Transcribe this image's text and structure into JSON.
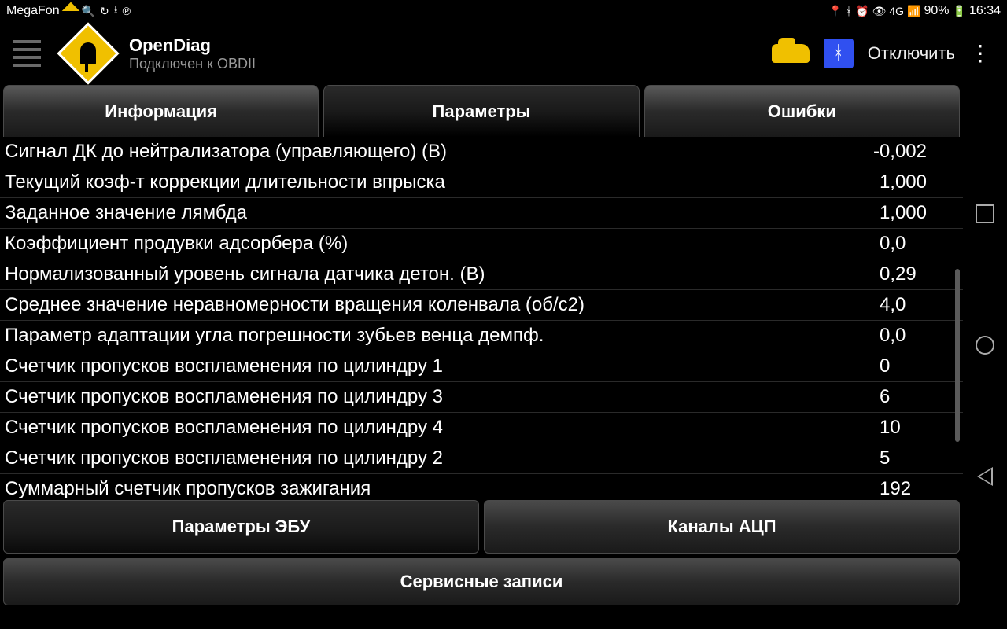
{
  "status": {
    "carrier": "MegaFon",
    "battery": "90%",
    "time": "16:34",
    "net": "4G"
  },
  "header": {
    "title": "OpenDiag",
    "subtitle": "Подключен к OBDII",
    "disconnect": "Отключить"
  },
  "tabs": {
    "info": "Информация",
    "params": "Параметры",
    "errors": "Ошибки"
  },
  "params": [
    {
      "name": "Сигнал ДК до нейтрализатора (управляющего) (В)",
      "value": "-0,002"
    },
    {
      "name": "Текущий коэф-т коррекции длительности впрыска",
      "value": "1,000"
    },
    {
      "name": "Заданное значение лямбда",
      "value": "1,000"
    },
    {
      "name": "Коэффициент продувки адсорбера (%)",
      "value": "0,0"
    },
    {
      "name": "Нормализованный уровень сигнала датчика детон. (В)",
      "value": "0,29"
    },
    {
      "name": "Среднее значение неравномерности вращения коленвала (об/с2)",
      "value": "4,0"
    },
    {
      "name": "Параметр адаптации угла погрешности зубьев венца демпф.",
      "value": "0,0"
    },
    {
      "name": "Счетчик пропусков воспламенения по цилиндру 1",
      "value": "0"
    },
    {
      "name": "Счетчик пропусков воспламенения по цилиндру 3",
      "value": "6"
    },
    {
      "name": "Счетчик пропусков воспламенения по цилиндру 4",
      "value": "10"
    },
    {
      "name": "Счетчик пропусков воспламенения по цилиндру 2",
      "value": "5"
    },
    {
      "name": "Суммарный счетчик пропусков зажигания",
      "value": "192"
    }
  ],
  "bottom": {
    "ecu": "Параметры ЭБУ",
    "adc": "Каналы АЦП",
    "service": "Сервисные записи"
  }
}
